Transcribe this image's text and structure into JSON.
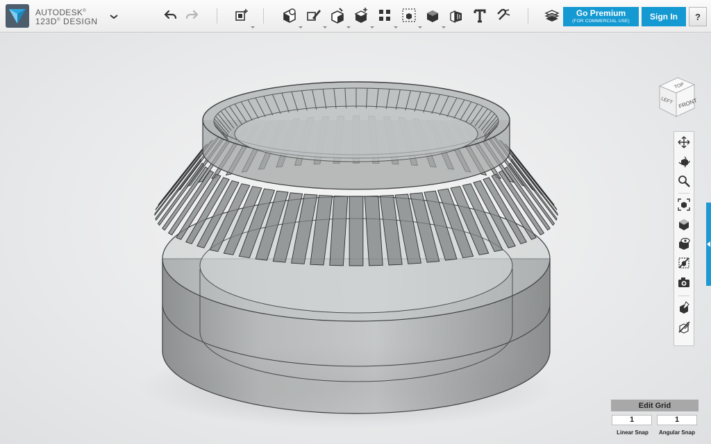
{
  "app": {
    "brand_line1": "AUTODESK",
    "brand_line2": "123D DESIGN",
    "brand_line2_main": "123D",
    "brand_line2_sup": "®",
    "brand_line2_rest": " DESIGN",
    "brand_line1_sup": "®"
  },
  "toolbar": {
    "buttons": [
      "undo-icon",
      "redo-icon",
      "transform-icon",
      "primitives-icon",
      "sketch-icon",
      "construct-icon",
      "modify-icon",
      "pattern-icon",
      "grouping-icon",
      "combine-icon",
      "measure-icon",
      "text-icon",
      "snap-icon",
      "materials-icon"
    ],
    "premium_label": "Go Premium",
    "premium_sub": "(FOR COMMERCIAL USE)",
    "signin_label": "Sign In",
    "help_label": "?"
  },
  "viewcube": {
    "top_label": "TOP",
    "front_label": "FRONT",
    "left_label": "LEFT"
  },
  "navbar": {
    "items": [
      "pan-icon",
      "orbit-icon",
      "zoom-icon",
      "fit-icon",
      "view-mode-icon",
      "visibility-icon",
      "materials-toggle-icon",
      "screenshot-icon",
      "edit-grid-icon",
      "hide-show-icon"
    ]
  },
  "grid": {
    "title": "Edit Grid",
    "linear_value": "1",
    "angular_value": "1",
    "linear_label": "Linear Snap",
    "angular_label": "Angular Snap"
  },
  "colors": {
    "accent": "#1499d2",
    "toolbar_bg": "#f2f2f2",
    "viewport_bg": "#e9eaeb",
    "model_fill": "#8f9292"
  }
}
